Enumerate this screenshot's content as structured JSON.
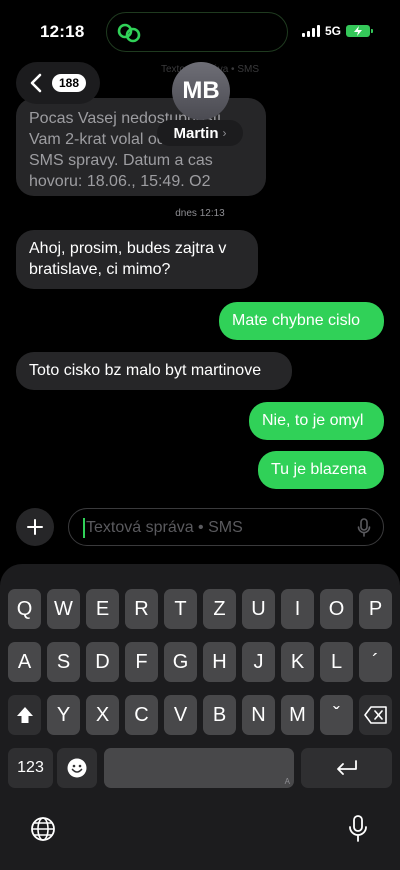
{
  "status": {
    "time": "12:18",
    "network": "5G"
  },
  "header": {
    "back_count": "188",
    "ghost_text": "Textová správa • SMS",
    "avatar_initials": "MB",
    "contact_name": "Martin"
  },
  "messages": {
    "old_text": "Pocas Vasej nedostupnosti Vam 2-krat volal odosielatel SMS spravy. Datum a cas hovoru: 18.06., 15:49. O2",
    "date_label": "dnes",
    "date_time": "12:13",
    "m1": "Ahoj, prosim, budes zajtra v bratislave, ci mimo?",
    "m2": "Mate chybne cislo",
    "m3": "Toto cisko bz malo byt martinove",
    "m4": "Nie, to je omyl",
    "m5": "Tu je blazena"
  },
  "input": {
    "placeholder": "Textová správa • SMS"
  },
  "keyboard": {
    "row1": [
      "Q",
      "W",
      "E",
      "R",
      "T",
      "Z",
      "U",
      "I",
      "O",
      "P"
    ],
    "row2": [
      "A",
      "S",
      "D",
      "F",
      "G",
      "H",
      "J",
      "K",
      "L",
      "´"
    ],
    "row3": [
      "Y",
      "X",
      "C",
      "V",
      "B",
      "N",
      "M",
      "ˇ"
    ],
    "numbers_label": "123",
    "space_hint": "A"
  },
  "colors": {
    "outgoing": "#30d158",
    "incoming": "#262628",
    "keyboard_bg": "#1c1c1e",
    "key": "#48484a"
  }
}
